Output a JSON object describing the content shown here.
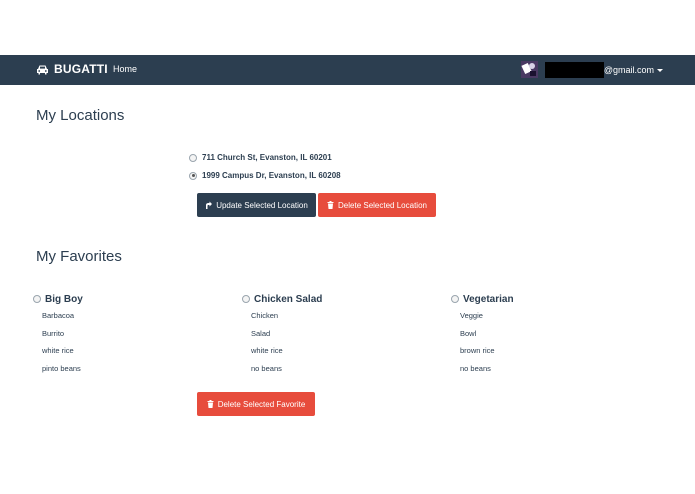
{
  "navbar": {
    "brand": "BUGATTI",
    "home": "Home",
    "email_suffix": "@gmail.com",
    "icons": {
      "brand": "car-icon",
      "avatar": "user-avatar",
      "caret": "caret-down-icon"
    }
  },
  "locations": {
    "title": "My Locations",
    "options": [
      {
        "label": "711 Church St, Evanston, IL 60201",
        "selected": false
      },
      {
        "label": "1999 Campus Dr, Evanston, IL 60208",
        "selected": true
      }
    ],
    "update_label": "Update Selected Location",
    "delete_label": "Delete Selected Location"
  },
  "favorites": {
    "title": "My Favorites",
    "items": [
      {
        "name": "Big Boy",
        "ingredients": [
          "Barbacoa",
          "Burrito",
          "white rice",
          "pinto beans"
        ],
        "selected": false
      },
      {
        "name": "Chicken Salad",
        "ingredients": [
          "Chicken",
          "Salad",
          "white rice",
          "no beans"
        ],
        "selected": false
      },
      {
        "name": "Vegetarian",
        "ingredients": [
          "Veggie",
          "Bowl",
          "brown rice",
          "no beans"
        ],
        "selected": false
      }
    ],
    "delete_label": "Delete Selected Favorite"
  },
  "colors": {
    "navbar": "#2c3e50",
    "primary": "#2c3e50",
    "danger": "#e74c3c"
  }
}
